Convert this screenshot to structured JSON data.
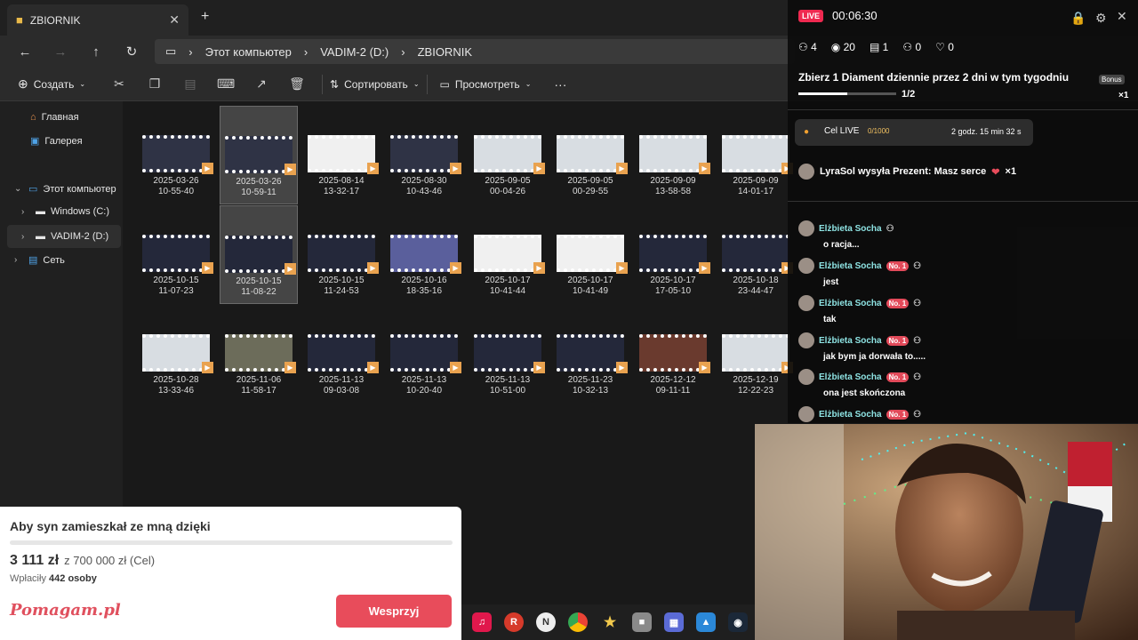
{
  "explorer": {
    "tab_title": "ZBIORNIK",
    "tab_close": "✕",
    "new_tab": "+",
    "breadcrumb": [
      "Этот компьютер",
      "VADIM-2 (D:)",
      "ZBIORNIK"
    ],
    "toolbar": {
      "create": "Создать",
      "sort": "Сортировать",
      "view": "Просмотреть",
      "more": "···"
    },
    "sidebar": [
      {
        "label": "Главная"
      },
      {
        "label": "Галерея"
      },
      {
        "label": "Этот компьютер"
      },
      {
        "label": "Windows (C:)"
      },
      {
        "label": "VADIM-2 (D:)"
      },
      {
        "label": "Сеть"
      }
    ],
    "files": [
      {
        "date": "2025-03-26",
        "time": "10-55-40",
        "thumb": "dark"
      },
      {
        "date": "2025-03-26",
        "time": "10-59-11",
        "thumb": "dark"
      },
      {
        "date": "2025-08-14",
        "time": "13-32-17",
        "thumb": "white"
      },
      {
        "date": "2025-08-30",
        "time": "10-43-46",
        "thumb": "dark"
      },
      {
        "date": "2025-09-05",
        "time": "00-04-26",
        "thumb": "light"
      },
      {
        "date": "2025-09-05",
        "time": "00-29-55",
        "thumb": "light"
      },
      {
        "date": "2025-09-09",
        "time": "13-58-58",
        "thumb": "light"
      },
      {
        "date": "2025-09-09",
        "time": "14-01-17",
        "thumb": "light"
      },
      {
        "date": "2025-10-15",
        "time": "11-07-23",
        "thumb": "navy"
      },
      {
        "date": "2025-10-15",
        "time": "11-08-22",
        "thumb": "navy"
      },
      {
        "date": "2025-10-15",
        "time": "11-24-53",
        "thumb": "navy"
      },
      {
        "date": "2025-10-16",
        "time": "18-35-16",
        "thumb": "blue"
      },
      {
        "date": "2025-10-17",
        "time": "10-41-44",
        "thumb": "white"
      },
      {
        "date": "2025-10-17",
        "time": "10-41-49",
        "thumb": "white"
      },
      {
        "date": "2025-10-17",
        "time": "17-05-10",
        "thumb": "navy"
      },
      {
        "date": "2025-10-18",
        "time": "23-44-47",
        "thumb": "navy"
      },
      {
        "date": "2025-10-28",
        "time": "13-33-46",
        "thumb": "light"
      },
      {
        "date": "2025-11-06",
        "time": "11-58-17",
        "thumb": "gray"
      },
      {
        "date": "2025-11-13",
        "time": "09-03-08",
        "thumb": "navy"
      },
      {
        "date": "2025-11-13",
        "time": "10-20-40",
        "thumb": "navy"
      },
      {
        "date": "2025-11-13",
        "time": "10-51-00",
        "thumb": "navy"
      },
      {
        "date": "2025-11-23",
        "time": "10-32-13",
        "thumb": "navy"
      },
      {
        "date": "2025-12-12",
        "time": "09-11-11",
        "thumb": "red"
      },
      {
        "date": "2025-12-19",
        "time": "12-22-23",
        "thumb": "light"
      }
    ]
  },
  "live": {
    "badge": "LIVE",
    "timer": "00:06:30",
    "stats": {
      "people": "4",
      "views": "20",
      "gifts": "1",
      "users": "0",
      "likes": "0"
    },
    "quest_title": "Zbierz 1 Diament dziennie przez 2 dni w tym tygodniu",
    "quest_progress": "1/2",
    "quest_progress_value": 0.5,
    "bonus_label": "Bonus",
    "bonus_count": "×1",
    "goal_label": "Cel LIVE",
    "goal_count": "0/1000",
    "goal_time": "2 godz. 15 min 32 s",
    "gift_text": "LyraSol wysyła Prezent: Masz serce",
    "gift_count": "×1",
    "chat": [
      {
        "name": "Elżbieta Socha",
        "badge": "",
        "msg": "o racja..."
      },
      {
        "name": "Elżbieta Socha",
        "badge": "No. 1",
        "msg": "jest"
      },
      {
        "name": "Elżbieta Socha",
        "badge": "No. 1",
        "msg": "tak"
      },
      {
        "name": "Elżbieta Socha",
        "badge": "No. 1",
        "msg": "jak bym ja dorwała to....."
      },
      {
        "name": "Elżbieta Socha",
        "badge": "No. 1",
        "msg": "ona jest skończona"
      },
      {
        "name": "Elżbieta Socha",
        "badge": "No. 1",
        "msg": ""
      }
    ]
  },
  "fundraiser": {
    "title": "Aby syn zamieszkał ze mną dzięki",
    "amount": "3 111 zł",
    "target": "z 700 000 zł (Cel)",
    "payers_prefix": "Wpłaciły",
    "payers_count": "442",
    "payers_suffix": "osoby",
    "logo": "Pomagam.pl",
    "button": "Wesprzyj"
  },
  "colors": {
    "accent": "#e84c5b",
    "live": "#ef2950",
    "folder": "#e9b949"
  }
}
